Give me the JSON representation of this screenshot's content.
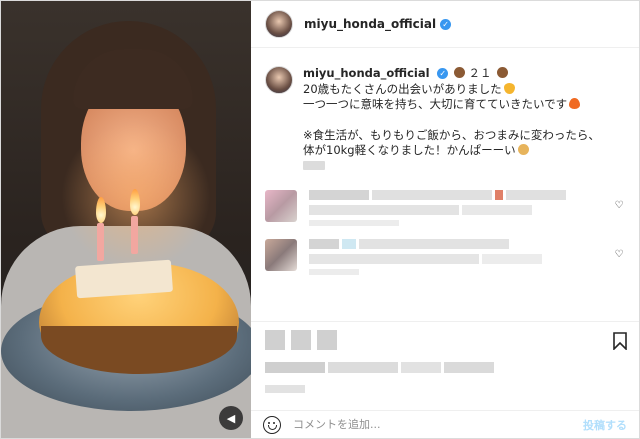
{
  "post": {
    "username": "miyu_honda_official",
    "verified_icon": "verified-badge-icon",
    "mute_icon": "speaker-muted-icon"
  },
  "caption": {
    "username": "miyu_honda_official",
    "title_suffix": "２１",
    "lines": [
      "20歳もたくさんの出会いがありました",
      "一つ一つに意味を持ち、大切に育てていきたいです",
      "※食生活が、もりもりご飯から、おつまみに変わったら、",
      "体が10kg軽くなりました！かんぱーーい"
    ]
  },
  "comment_box": {
    "placeholder": "コメントを追加...",
    "post_label": "投稿する"
  },
  "colors": {
    "verified": "#3897f0",
    "post_button": "#b2dffc"
  }
}
